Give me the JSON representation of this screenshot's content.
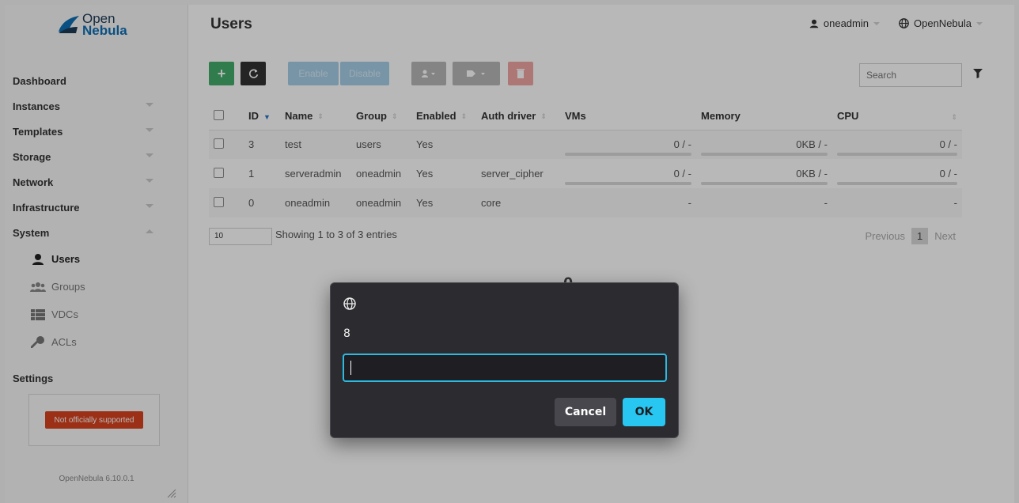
{
  "brand": {
    "line1": "Open",
    "line2": "Nebula"
  },
  "page": {
    "title": "Users"
  },
  "topbar": {
    "user": "oneadmin",
    "zone": "OpenNebula"
  },
  "sidebar": {
    "items": [
      {
        "label": "Dashboard"
      },
      {
        "label": "Instances"
      },
      {
        "label": "Templates"
      },
      {
        "label": "Storage"
      },
      {
        "label": "Network"
      },
      {
        "label": "Infrastructure"
      },
      {
        "label": "System"
      }
    ],
    "system_sub": [
      {
        "label": "Users",
        "icon": "user-icon"
      },
      {
        "label": "Groups",
        "icon": "groups-icon"
      },
      {
        "label": "VDCs",
        "icon": "vdcs-icon"
      },
      {
        "label": "ACLs",
        "icon": "key-icon"
      }
    ],
    "settings": "Settings",
    "support_badge": "Not officially supported",
    "version": "OpenNebula 6.10.0.1"
  },
  "toolbar": {
    "add": "+",
    "enable": "Enable",
    "disable": "Disable",
    "search_placeholder": "Search"
  },
  "table": {
    "headers": [
      "ID",
      "Name",
      "Group",
      "Enabled",
      "Auth driver",
      "VMs",
      "Memory",
      "CPU"
    ],
    "rows": [
      {
        "id": "3",
        "name": "test",
        "group": "users",
        "enabled": "Yes",
        "auth": "",
        "vms": "0 / -",
        "memory": "0KB / -",
        "cpu": "0 / -"
      },
      {
        "id": "1",
        "name": "serveradmin",
        "group": "oneadmin",
        "enabled": "Yes",
        "auth": "server_cipher",
        "vms": "0 / -",
        "memory": "0KB / -",
        "cpu": "0 / -"
      },
      {
        "id": "0",
        "name": "oneadmin",
        "group": "oneadmin",
        "enabled": "Yes",
        "auth": "core",
        "vms": "-",
        "memory": "-",
        "cpu": "-"
      }
    ]
  },
  "footer": {
    "page_length": "10",
    "showing": "Showing 1 to 3 of 3 entries",
    "previous": "Previous",
    "current_page": "1",
    "next": "Next",
    "total_partial": "0"
  },
  "dialog": {
    "message": "8",
    "input_value": "",
    "cancel": "Cancel",
    "ok": "OK",
    "accent": "#28c7f2"
  }
}
